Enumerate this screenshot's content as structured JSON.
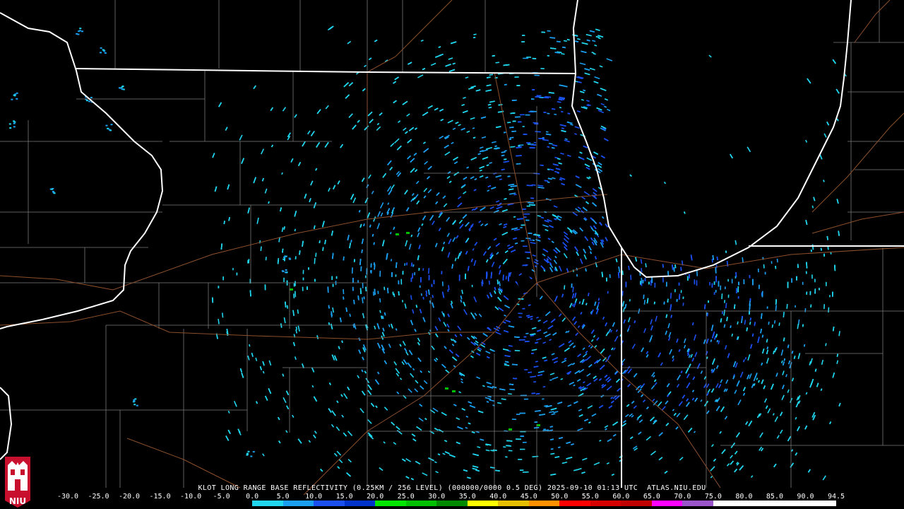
{
  "caption": "KLOT LONG RANGE BASE REFLECTIVITY (0.25KM / 256 LEVEL) (000000/0000 0.5 DEG) 2025-09-10 01:13 UTC  ATLAS.NIU.EDU",
  "logo_text": "NIU",
  "colorscale": {
    "ticks": [
      "-30.0",
      "-25.0",
      "-20.0",
      "-15.0",
      "-10.0",
      "-5.0",
      "0.0",
      "5.0",
      "10.0",
      "15.0",
      "20.0",
      "25.0",
      "30.0",
      "35.0",
      "40.0",
      "45.0",
      "50.0",
      "55.0",
      "60.0",
      "65.0",
      "70.0",
      "75.0",
      "80.0",
      "85.0",
      "90.0",
      "94.5"
    ],
    "colors": [
      "#000000",
      "#000000",
      "#000000",
      "#000000",
      "#000000",
      "#000000",
      "#1fd6ee",
      "#1a9ff0",
      "#1a4ff0",
      "#0033cc",
      "#00e600",
      "#00c000",
      "#008a00",
      "#ffff00",
      "#e6c000",
      "#ff9000",
      "#ff0000",
      "#d60000",
      "#c00000",
      "#ff00ff",
      "#9955c9",
      "#ffffff",
      "#ffffff",
      "#ffffff",
      "#ffffff"
    ]
  },
  "radar": {
    "site": "KLOT",
    "center_label": ""
  },
  "colors": {
    "state_line": "#ffffff",
    "county_line": "#8a8a8a",
    "road": "#8a5030",
    "echo_light": "#1fd6ee",
    "echo_mid": "#1a9ff0",
    "echo_dark": "#1a4ff0",
    "echo_green": "#00c000"
  }
}
